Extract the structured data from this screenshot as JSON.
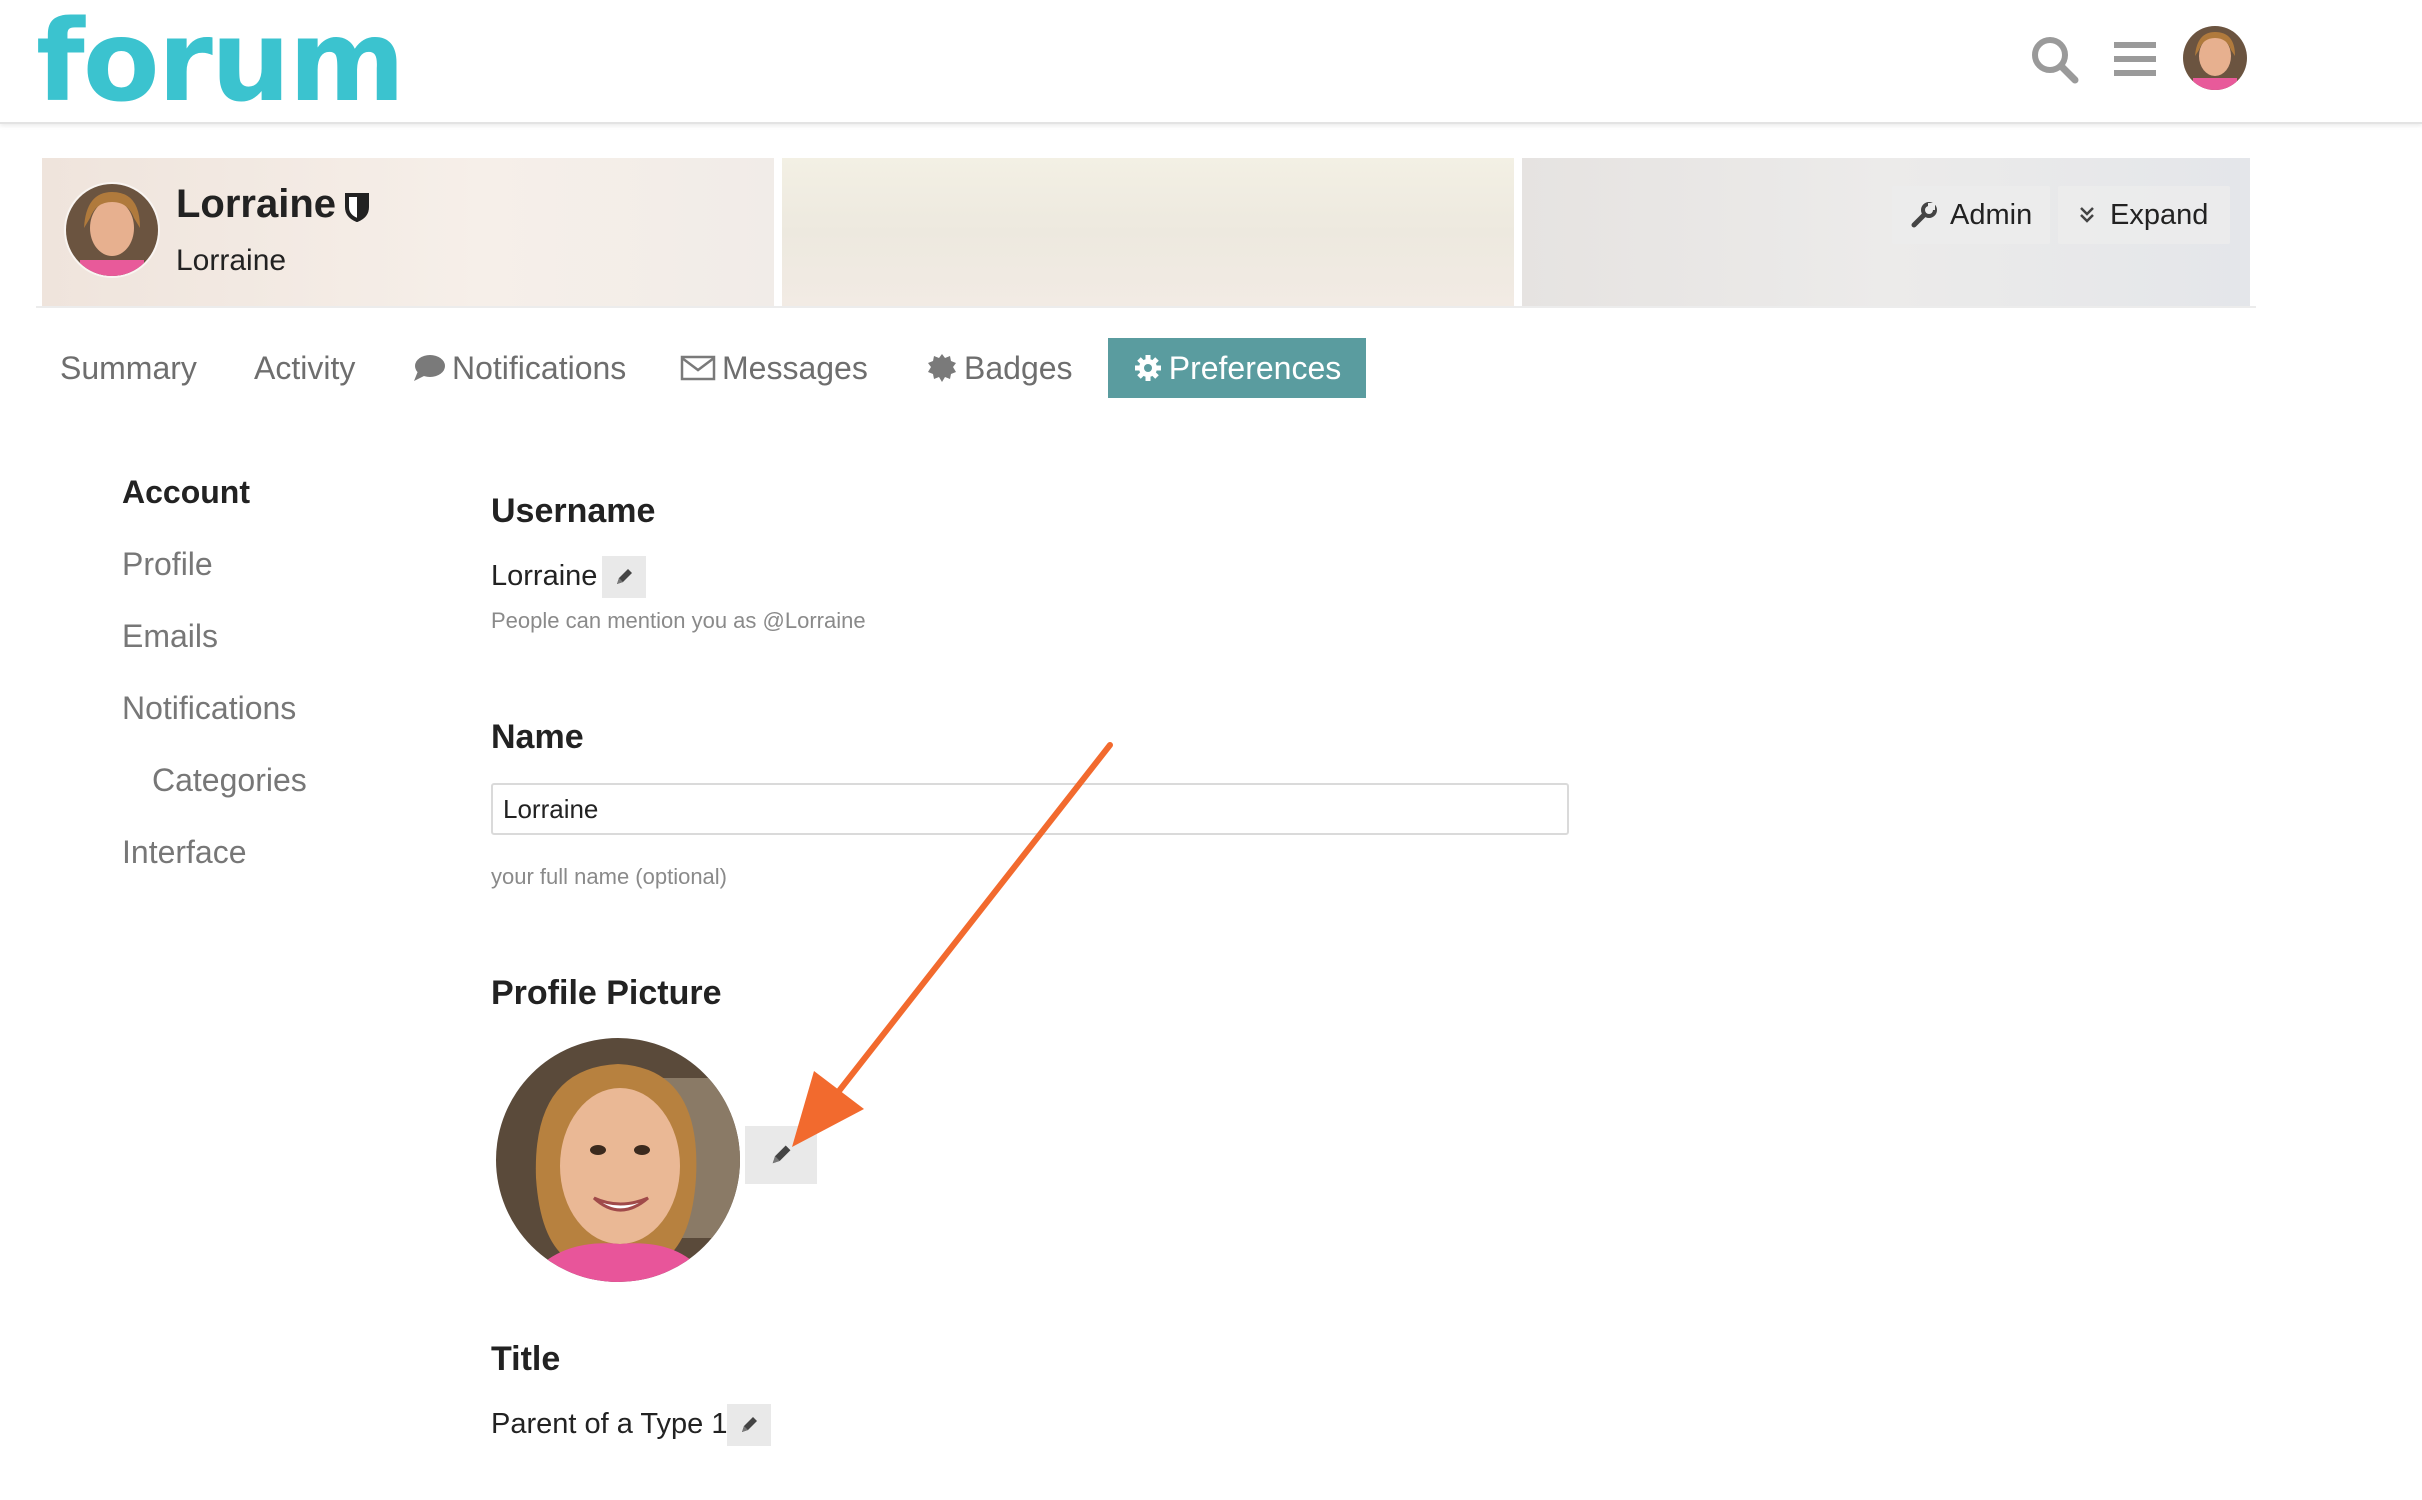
{
  "header": {
    "logo_text": "forum",
    "logo_color": "#3bc3cf",
    "icons": [
      "search-icon",
      "hamburger-menu-icon",
      "user-avatar"
    ]
  },
  "user": {
    "username": "Lorraine",
    "name": "Lorraine",
    "admin_label": "Admin",
    "expand_label": "Expand"
  },
  "tabs": [
    {
      "label": "Summary"
    },
    {
      "label": "Activity"
    },
    {
      "label": "Notifications"
    },
    {
      "label": "Messages"
    },
    {
      "label": "Badges"
    },
    {
      "label": "Preferences",
      "active": true
    }
  ],
  "sidebar": {
    "items": [
      {
        "label": "Account",
        "active": true
      },
      {
        "label": "Profile"
      },
      {
        "label": "Emails"
      },
      {
        "label": "Notifications"
      },
      {
        "label": "Categories"
      },
      {
        "label": "Interface"
      }
    ]
  },
  "form": {
    "username": {
      "label": "Username",
      "value": "Lorraine",
      "help": "People can mention you as @Lorraine"
    },
    "name": {
      "label": "Name",
      "value": "Lorraine",
      "help": "your full name (optional)"
    },
    "profile_picture": {
      "label": "Profile Picture"
    },
    "title": {
      "label": "Title",
      "value": "Parent of a Type 1"
    }
  },
  "colors": {
    "accent_tab": "#5a9c9f",
    "annotation_arrow": "#f26a2e"
  }
}
